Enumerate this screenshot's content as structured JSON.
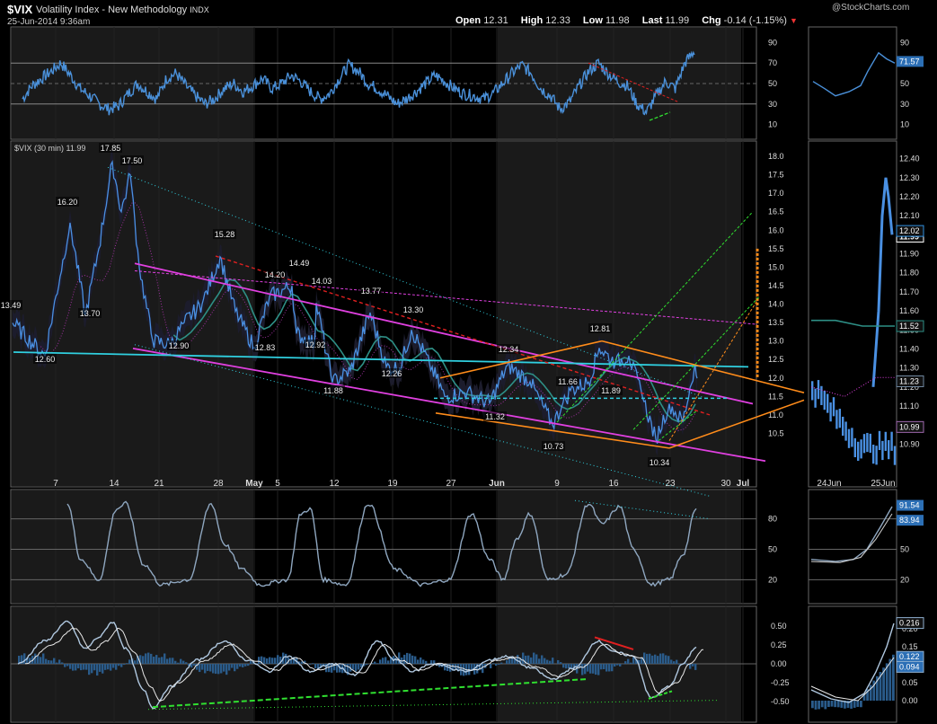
{
  "header": {
    "symbol": "$VIX",
    "name": "Volatility Index - New Methodology",
    "exchange": "INDX",
    "date": "25-Jun-2014 9:36am",
    "credit": "@StockCharts.com",
    "open_label": "Open",
    "open": "12.31",
    "high_label": "High",
    "high": "12.33",
    "low_label": "Low",
    "low": "11.98",
    "last_label": "Last",
    "last": "11.99",
    "chg_label": "Chg",
    "chg": "-0.14 (-1.15%)",
    "chg_arrow": "▼"
  },
  "colors": {
    "price": "#4a90e2",
    "rsi": "#4a90d9",
    "channel_magenta": "#e040e0",
    "orange": "#ff8c1a",
    "cyan": "#30d0e0",
    "red": "#e02020",
    "green": "#30e030",
    "ma_teal": "#2e8f86",
    "shade": "#1a1a1a"
  },
  "x_axis": {
    "ticks": [
      "7",
      "14",
      "21",
      "28",
      "May",
      "5",
      "12",
      "19",
      "27",
      "Jun",
      "9",
      "16",
      "23",
      "30",
      "Jul"
    ],
    "intraday_ticks": [
      "24Jun",
      "25Jun"
    ]
  },
  "chart_data": [
    {
      "type": "line",
      "panel": "rsi",
      "ylim": [
        0,
        100
      ],
      "y_ticks": [
        10,
        30,
        50,
        70,
        90
      ],
      "current_value": 71.57,
      "sparse_values_by_session": [
        35,
        48,
        55,
        62,
        70,
        58,
        45,
        38,
        30,
        25,
        28,
        40,
        50,
        42,
        35,
        55,
        60,
        48,
        38,
        30,
        35,
        45,
        50,
        42,
        48,
        55,
        45,
        50,
        58,
        52,
        42,
        35,
        40,
        55,
        68,
        62,
        50,
        45,
        38,
        30,
        35,
        42,
        50,
        58,
        52,
        45,
        40,
        38,
        35,
        40,
        50,
        60,
        68,
        60,
        45,
        38,
        25,
        32,
        48,
        62,
        70,
        60,
        52,
        48,
        30,
        22,
        38,
        52,
        45,
        70,
        82
      ]
    },
    {
      "type": "line",
      "panel": "price",
      "title": "$VIX (30 min) 11.99",
      "ylim": [
        10.0,
        18.0
      ],
      "y_ticks": [
        10.5,
        11.0,
        11.5,
        12.0,
        12.5,
        13.0,
        13.5,
        14.0,
        14.5,
        15.0,
        15.5,
        16.0,
        16.5,
        17.0,
        17.5,
        18.0
      ],
      "annotations": [
        "13.49",
        "17.85",
        "17.50",
        "16.20",
        "13.70",
        "12.60",
        "12.90",
        "15.28",
        "14.20",
        "14.49",
        "14.03",
        "12.83",
        "12.92",
        "11.88",
        "13.77",
        "13.30",
        "12.26",
        "12.34",
        "11.66",
        "11.89",
        "11.32",
        "10.73",
        "12.81",
        "10.34"
      ],
      "current_value": 11.99
    },
    {
      "type": "line",
      "panel": "intraday_price",
      "ylim": [
        10.85,
        12.45
      ],
      "y_ticks": [
        10.9,
        11.0,
        11.1,
        11.2,
        11.3,
        11.4,
        11.5,
        11.6,
        11.7,
        11.8,
        11.9,
        12.0,
        12.1,
        12.2,
        12.3,
        12.4
      ],
      "flags": [
        "11.99",
        "11.52",
        "11.23",
        "10.99",
        "12.02"
      ]
    },
    {
      "type": "line",
      "panel": "stochastic",
      "ylim": [
        0,
        100
      ],
      "y_ticks": [
        20,
        50,
        80
      ],
      "flags": [
        "91.54",
        "83.94"
      ]
    },
    {
      "type": "line",
      "panel": "macd",
      "ylim": [
        -0.6,
        0.6
      ],
      "y_ticks": [
        -0.5,
        -0.25,
        0.0,
        0.25,
        0.5
      ],
      "intraday_y_ticks": [
        0.0,
        0.05,
        0.1,
        0.15,
        0.2
      ],
      "flags": [
        "0.216",
        "0.122",
        "0.094"
      ]
    }
  ]
}
